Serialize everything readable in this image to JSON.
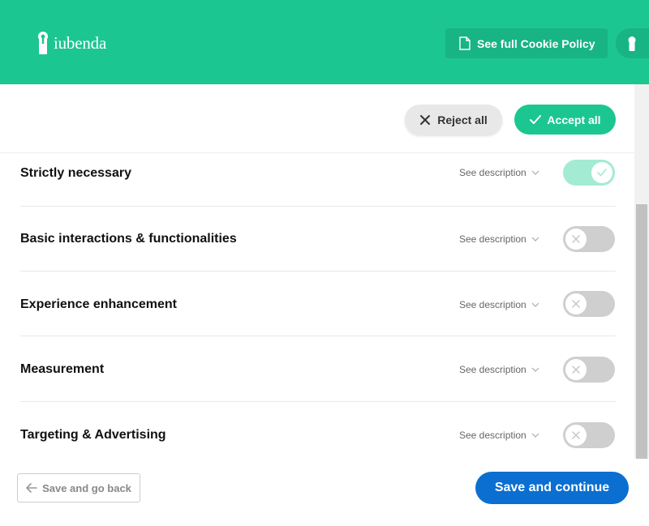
{
  "header": {
    "logo_text": "iubenda",
    "policy_button": "See full Cookie Policy"
  },
  "actions": {
    "reject_all": "Reject all",
    "accept_all": "Accept all"
  },
  "categories": [
    {
      "title": "Strictly necessary",
      "desc_label": "See description",
      "enabled": true
    },
    {
      "title": "Basic interactions & functionalities",
      "desc_label": "See description",
      "enabled": false
    },
    {
      "title": "Experience enhancement",
      "desc_label": "See description",
      "enabled": false
    },
    {
      "title": "Measurement",
      "desc_label": "See description",
      "enabled": false
    },
    {
      "title": "Targeting & Advertising",
      "desc_label": "See description",
      "enabled": false
    }
  ],
  "footer": {
    "back_label": "Save and go back",
    "continue_label": "Save and continue"
  },
  "colors": {
    "brand": "#1cc691",
    "primary": "#0a6fd0"
  }
}
